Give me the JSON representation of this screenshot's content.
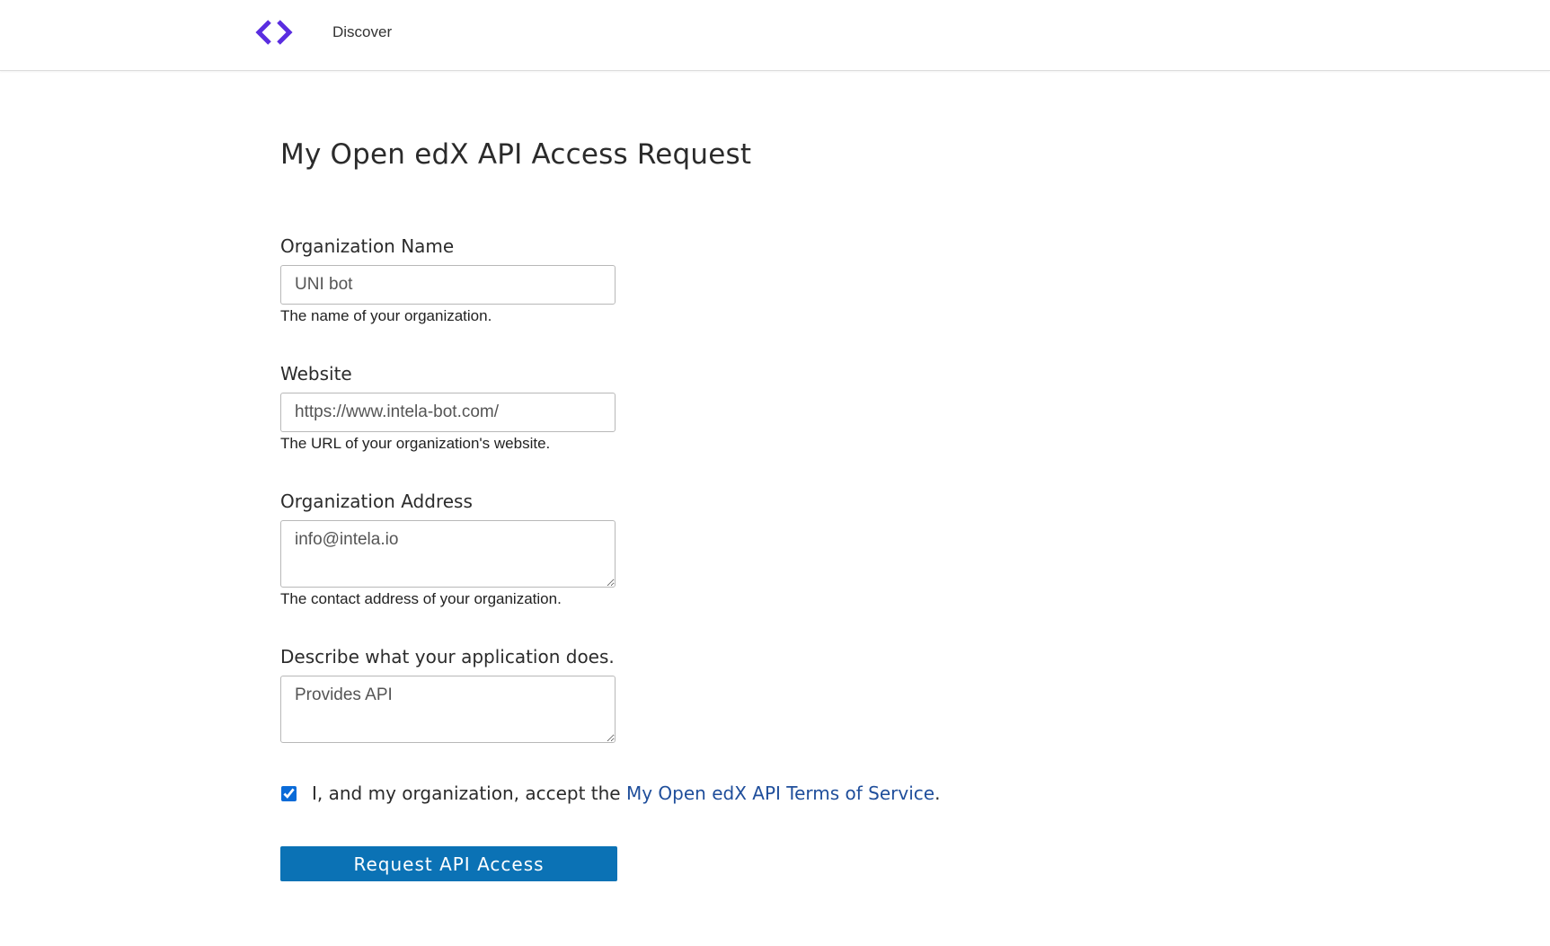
{
  "header": {
    "logo_icon": "code-brackets-icon",
    "logo_color": "#5a2de0",
    "nav_discover": "Discover"
  },
  "page": {
    "title": "My Open edX API Access Request"
  },
  "form": {
    "organization_name": {
      "label": "Organization Name",
      "value": "UNI bot",
      "help": "The name of your organization."
    },
    "website": {
      "label": "Website",
      "value": "https://www.intela-bot.com/",
      "help": "The URL of your organization's website."
    },
    "organization_address": {
      "label": "Organization Address",
      "value": "info@intela.io",
      "help": "The contact address of your organization."
    },
    "application_description": {
      "label": "Describe what your application does.",
      "value": "Provides API"
    },
    "terms": {
      "checked": true,
      "text_before": "I, and my organization, accept the ",
      "link_text": "My Open edX API Terms of Service",
      "text_after": "."
    },
    "submit_label": "Request API Access"
  },
  "colors": {
    "button": "#0b72b5",
    "link": "#1f4e9b",
    "logo": "#5a2de0"
  }
}
